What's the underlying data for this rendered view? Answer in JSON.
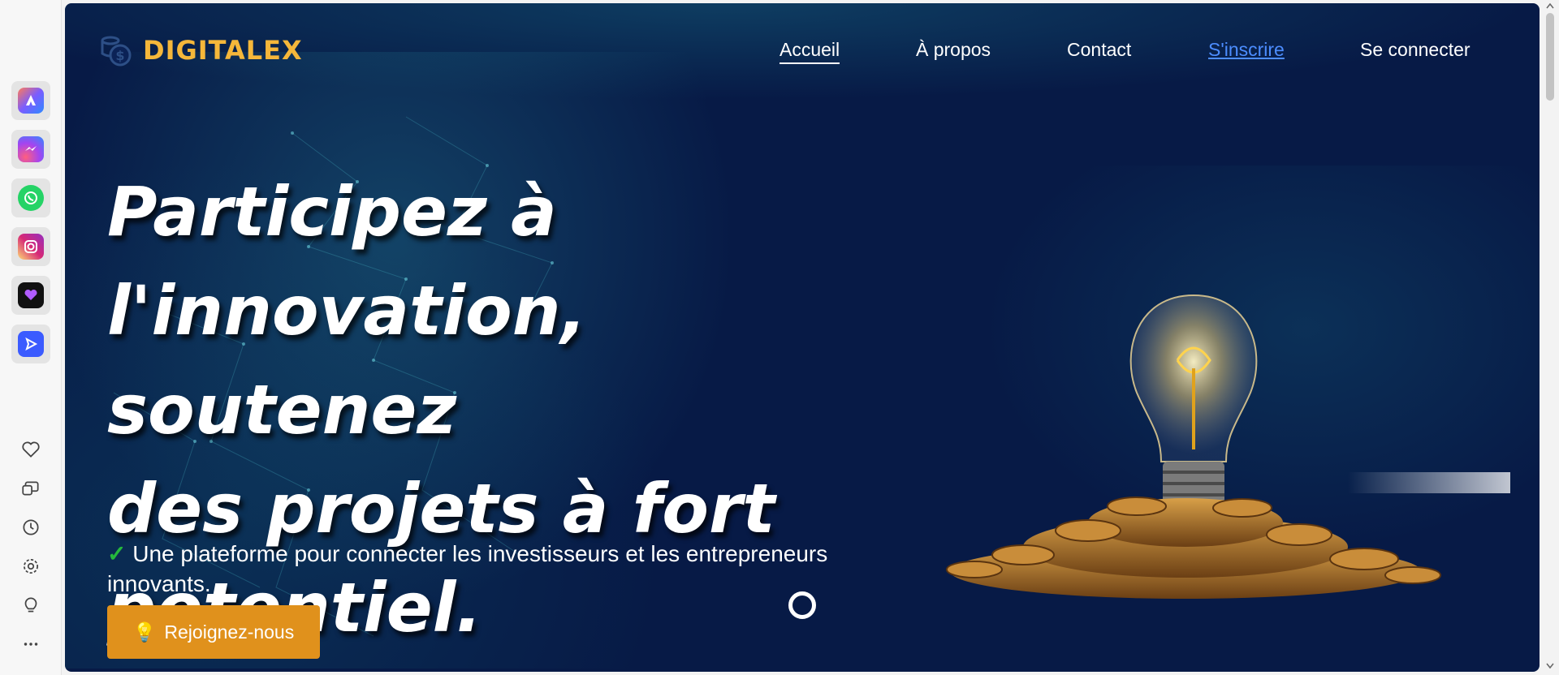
{
  "sidebar": {
    "apps": [
      {
        "name": "copilot-app",
        "color": "#5b5bd6"
      },
      {
        "name": "messenger-app",
        "color": "#a544f0"
      },
      {
        "name": "whatsapp-app",
        "color": "#25d366"
      },
      {
        "name": "instagram-app",
        "color": "#e1306c"
      },
      {
        "name": "tiktok-app",
        "color": "#111111"
      },
      {
        "name": "send-app",
        "color": "#3b5bff"
      }
    ],
    "tools": [
      "favorites-icon",
      "collections-icon",
      "history-icon",
      "settings-icon",
      "tips-icon",
      "more-icon"
    ]
  },
  "header": {
    "brand": "DIGITALEX",
    "nav": {
      "home": "Accueil",
      "about": "À propos",
      "contact": "Contact",
      "signup": "S'inscrire",
      "login": "Se connecter"
    }
  },
  "hero": {
    "headline_lines": [
      "Participez à",
      "l'innovation, soutenez",
      "des projets à fort",
      "potentiel."
    ],
    "check_mark": "✓",
    "subtitle": "Une plateforme pour connecter les investisseurs et les entrepreneurs innovants.",
    "cta_icon": "💡",
    "cta_label": "Rejoignez-nous"
  },
  "colors": {
    "background": "#071a46",
    "brand": "#f5b73a",
    "cta": "#e0911c",
    "link": "#4c8dff",
    "check": "#25b83c"
  }
}
